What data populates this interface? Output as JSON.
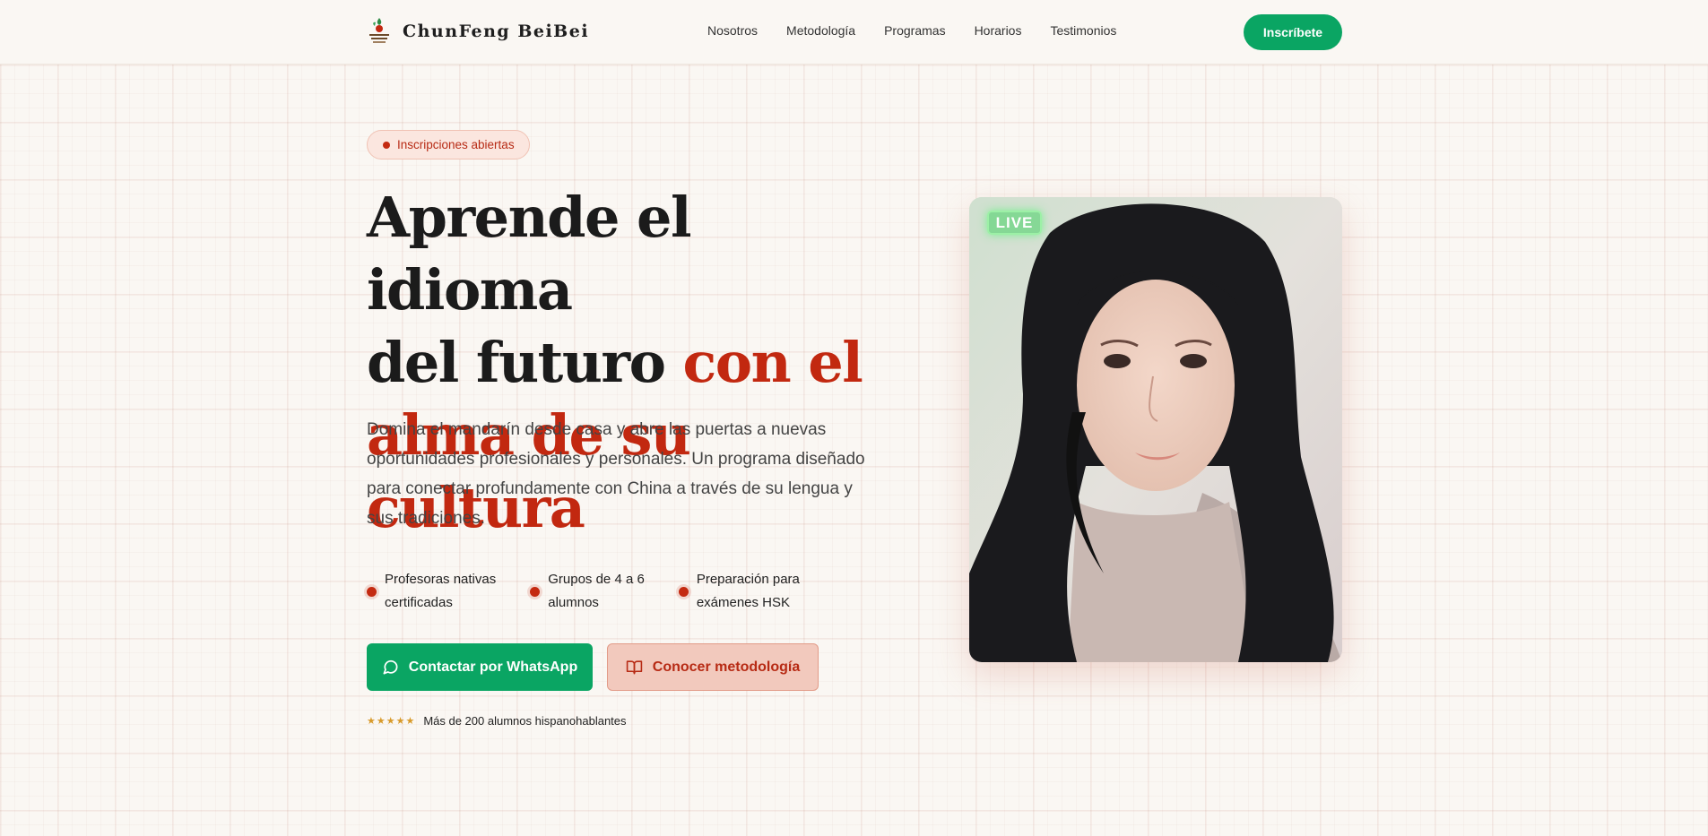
{
  "header": {
    "brand": "ChunFeng BeiBei",
    "nav": [
      "Nosotros",
      "Metodología",
      "Programas",
      "Horarios",
      "Testimonios"
    ],
    "cta": "Inscríbete"
  },
  "hero": {
    "badge": "Inscripciones abiertas",
    "title_line1": "Aprende el idioma",
    "title_line2_plain": "del futuro ",
    "title_line2_accent": "con el",
    "title_line3_accent": "alma de su cultura",
    "description": "Domina el mandarín desde casa y abre las puertas a nuevas oportunidades profesionales y personales. Un programa diseñado para conectar profundamente con China a través de su lengua y sus tradiciones.",
    "features": [
      {
        "line1": "Profesoras nativas",
        "line2": "certificadas"
      },
      {
        "line1": "Grupos de 4 a 6",
        "line2": "alumnos"
      },
      {
        "line1": "Preparación para",
        "line2": "exámenes HSK"
      }
    ],
    "btn_whatsapp": "Contactar por WhatsApp",
    "btn_methodology": "Conocer metodología",
    "stars": "★★★★★",
    "rating_text": "Más de 200 alumnos hispanohablantes"
  },
  "video": {
    "live_label": "LIVE"
  },
  "icons": {
    "logo": "logo-icon",
    "whatsapp": "whatsapp-icon",
    "book": "book-icon"
  },
  "colors": {
    "green": "#0aa563",
    "red": "#c22810",
    "background": "#faf7f3"
  }
}
